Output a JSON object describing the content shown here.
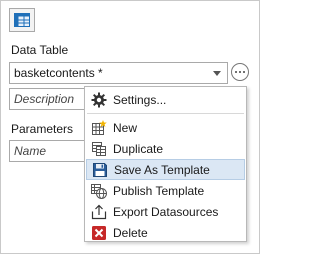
{
  "section": {
    "data_table_label": "Data Table",
    "data_table_value": "basketcontents *",
    "description_placeholder": "Description",
    "parameters_label": "Parameters",
    "name_placeholder": "Name"
  },
  "menu": {
    "items": [
      {
        "label": "Settings...",
        "icon": "gear-icon"
      },
      {
        "label": "New",
        "icon": "new-table-icon"
      },
      {
        "label": "Duplicate",
        "icon": "duplicate-icon"
      },
      {
        "label": "Save As Template",
        "icon": "save-icon",
        "highlighted": true
      },
      {
        "label": "Publish Template",
        "icon": "publish-icon"
      },
      {
        "label": "Export Datasources",
        "icon": "export-icon"
      },
      {
        "label": "Delete",
        "icon": "delete-icon"
      }
    ]
  },
  "colors": {
    "highlight": "#dbe7f4",
    "accent_blue": "#1f6fb8",
    "delete_red": "#c62828"
  }
}
